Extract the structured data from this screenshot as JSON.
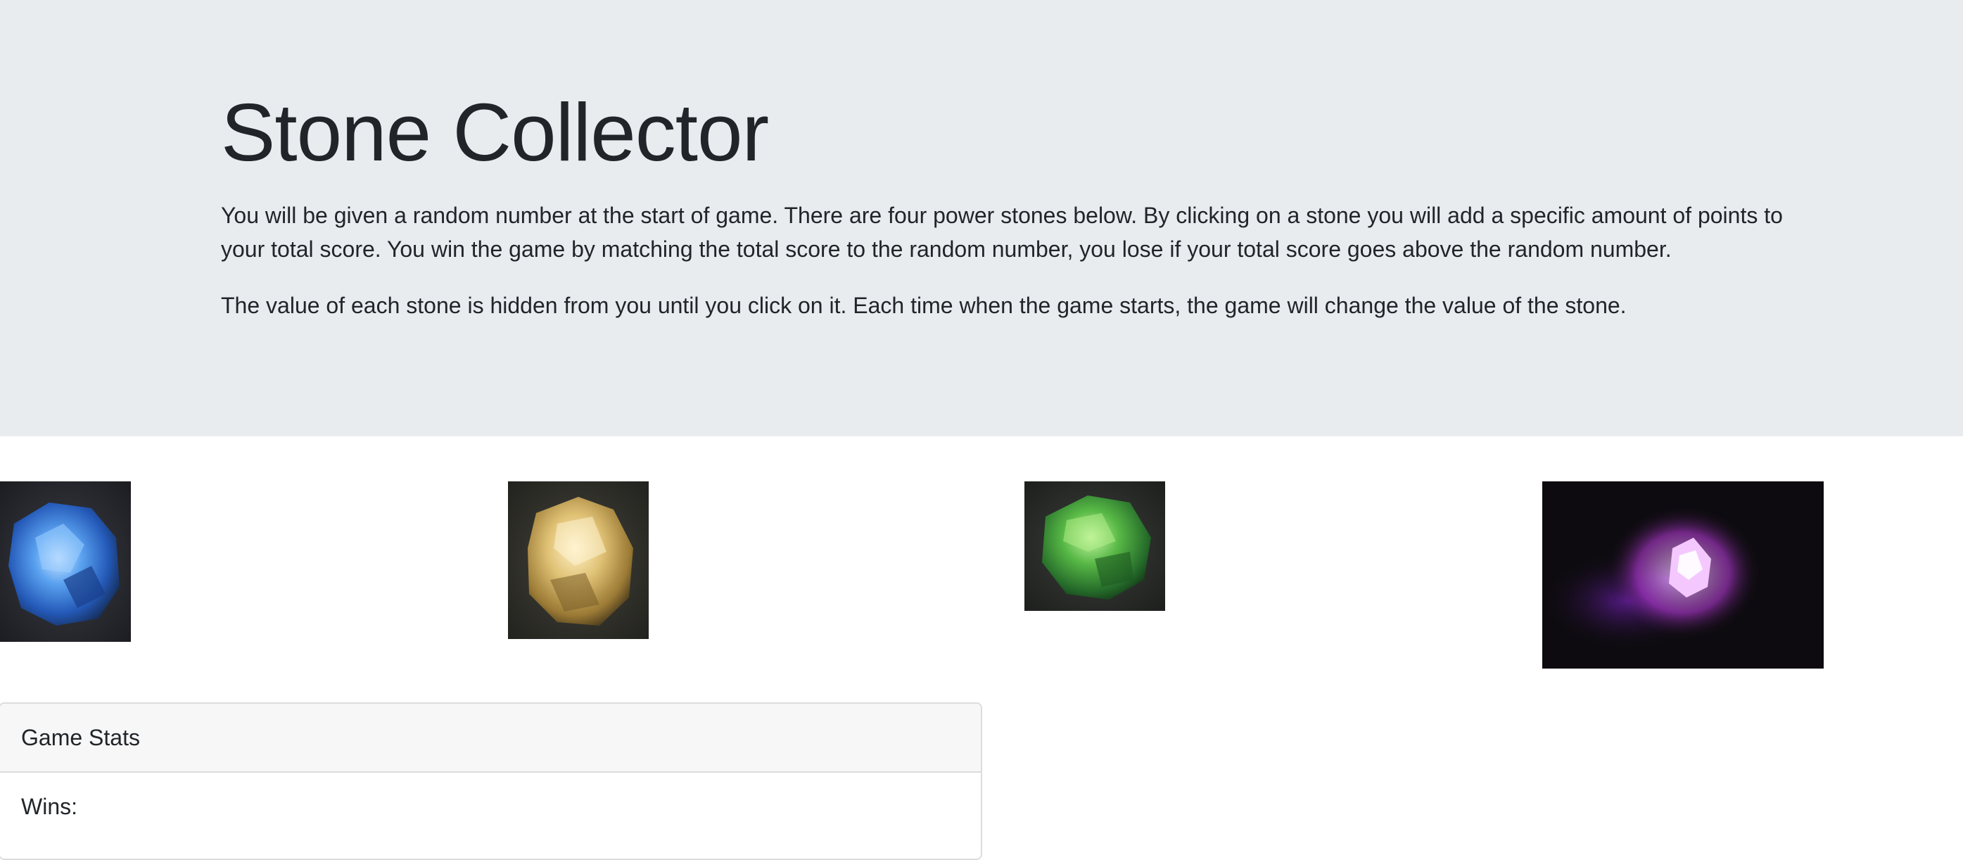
{
  "header": {
    "title": "Stone Collector",
    "paragraph1": "You will be given a random number at the start of game. There are four power stones below. By clicking on a stone you will add a specific amount of points to your total score. You win the game by matching the total score to the random number, you lose if your total score goes above the random number.",
    "paragraph2": "The value of each stone is hidden from you until you click on it. Each time when the game starts, the game will change the value of the stone."
  },
  "stones": [
    {
      "name": "blue-stone",
      "color": "#3f7fd8"
    },
    {
      "name": "yellow-stone",
      "color": "#d8b45a"
    },
    {
      "name": "green-stone",
      "color": "#4fae3c"
    },
    {
      "name": "purple-stone",
      "color": "#b02ee0"
    }
  ],
  "stats": {
    "title": "Game Stats",
    "wins_label": "Wins:",
    "wins_value": ""
  },
  "colors": {
    "jumbotron_bg": "#e9ecef",
    "card_header_bg": "#f7f7f7",
    "text": "#212529"
  }
}
